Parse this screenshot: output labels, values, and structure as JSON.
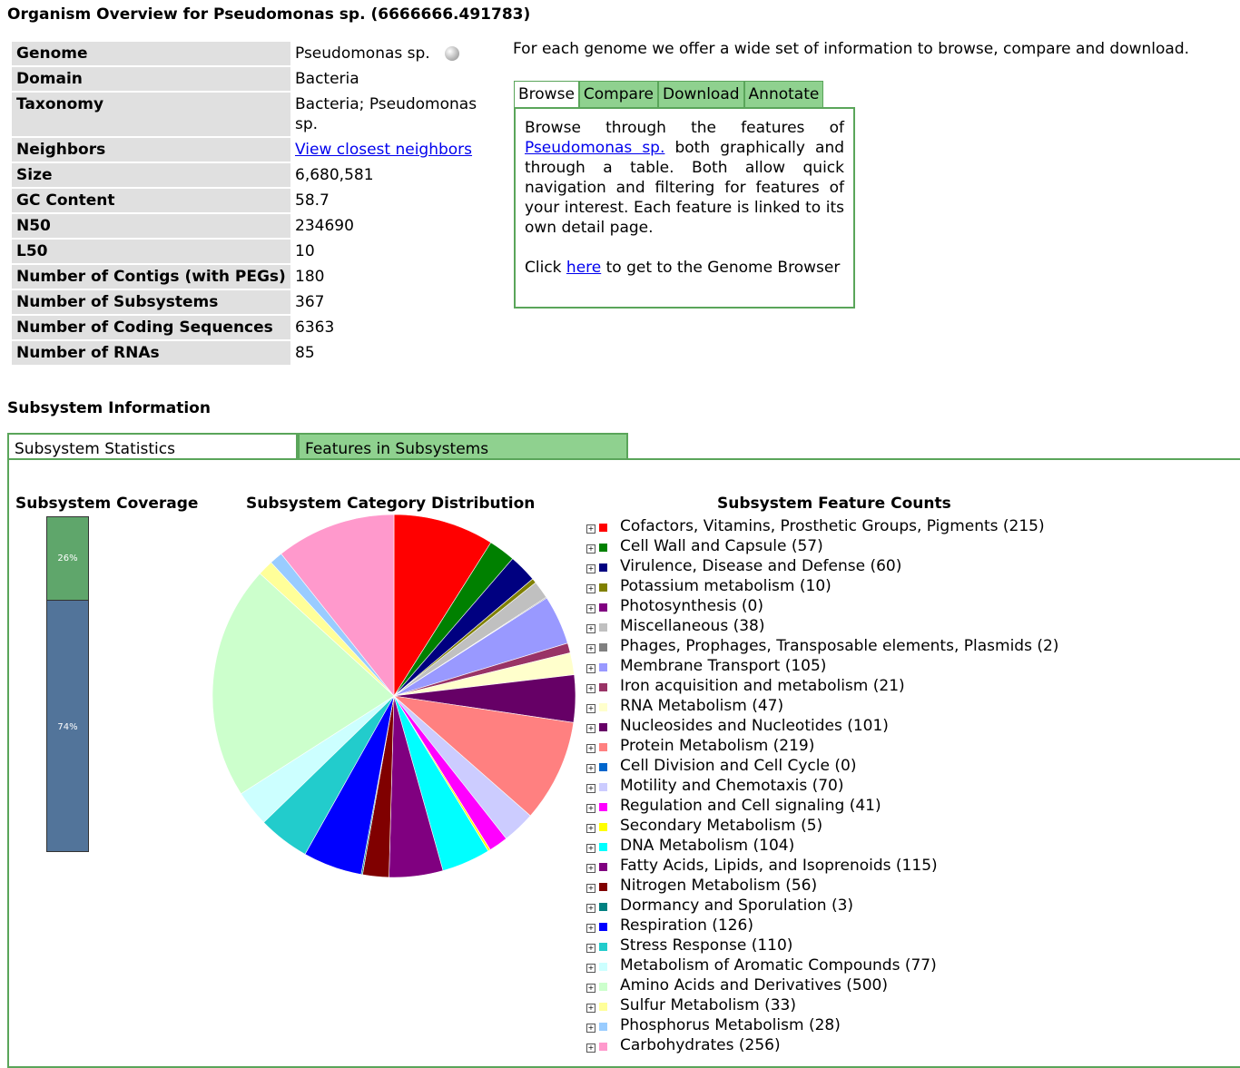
{
  "title": "Organism Overview for Pseudomonas sp. (6666666.491783)",
  "overview": [
    {
      "label": "Genome",
      "value": "Pseudomonas sp.",
      "globe": true
    },
    {
      "label": "Domain",
      "value": "Bacteria"
    },
    {
      "label": "Taxonomy",
      "value": "Bacteria; Pseudomonas sp."
    },
    {
      "label": "Neighbors",
      "value": "View closest neighbors",
      "link": true
    },
    {
      "label": "Size",
      "value": "6,680,581"
    },
    {
      "label": "GC Content",
      "value": "58.7"
    },
    {
      "label": "N50",
      "value": "234690"
    },
    {
      "label": "L50",
      "value": "10"
    },
    {
      "label": "Number of Contigs (with PEGs)",
      "value": "180"
    },
    {
      "label": "Number of Subsystems",
      "value": "367"
    },
    {
      "label": "Number of Coding Sequences",
      "value": "6363"
    },
    {
      "label": "Number of RNAs",
      "value": "85"
    }
  ],
  "intro": "For each genome we offer a wide set of information to browse, compare and download.",
  "tabs": [
    "Browse",
    "Compare",
    "Download",
    "Annotate"
  ],
  "browse": {
    "text1": "Browse through the features of",
    "link1": "Pseudomonas sp.",
    "text2": "both graphically and through a table. Both allow quick navigation and filtering for features of your interest. Each feature is linked to its own detail page.",
    "text3": "Click",
    "link2": "here",
    "text4": "to get to the Genome Browser"
  },
  "subsystem_info_title": "Subsystem Information",
  "subsystem_tabs": [
    "Subsystem Statistics",
    "Features in Subsystems"
  ],
  "coverage": {
    "title": "Subsystem Coverage",
    "in_subsystem": "26%",
    "not_in_subsystem": "74%",
    "fraction_in": 0.26
  },
  "pie_title": "Subsystem Category Distribution",
  "counts_title": "Subsystem Feature Counts",
  "chart_data": {
    "type": "pie",
    "title": "Subsystem Category Distribution",
    "series": [
      {
        "name": "Cofactors, Vitamins, Prosthetic Groups, Pigments",
        "value": 215,
        "color": "#ff0000"
      },
      {
        "name": "Cell Wall and Capsule",
        "value": 57,
        "color": "#008000"
      },
      {
        "name": "Virulence, Disease and Defense",
        "value": 60,
        "color": "#000080"
      },
      {
        "name": "Potassium metabolism",
        "value": 10,
        "color": "#808000"
      },
      {
        "name": "Photosynthesis",
        "value": 0,
        "color": "#800080"
      },
      {
        "name": "Miscellaneous",
        "value": 38,
        "color": "#c0c0c0"
      },
      {
        "name": "Phages, Prophages, Transposable elements, Plasmids",
        "value": 2,
        "color": "#808080"
      },
      {
        "name": "Membrane Transport",
        "value": 105,
        "color": "#9999ff"
      },
      {
        "name": "Iron acquisition and metabolism",
        "value": 21,
        "color": "#993366"
      },
      {
        "name": "RNA Metabolism",
        "value": 47,
        "color": "#ffffcc"
      },
      {
        "name": "Nucleosides and Nucleotides",
        "value": 101,
        "color": "#660066"
      },
      {
        "name": "Protein Metabolism",
        "value": 219,
        "color": "#ff8080"
      },
      {
        "name": "Cell Division and Cell Cycle",
        "value": 0,
        "color": "#0066cc"
      },
      {
        "name": "Motility and Chemotaxis",
        "value": 70,
        "color": "#ccccff"
      },
      {
        "name": "Regulation and Cell signaling",
        "value": 41,
        "color": "#ff00ff"
      },
      {
        "name": "Secondary Metabolism",
        "value": 5,
        "color": "#ffff00"
      },
      {
        "name": "DNA Metabolism",
        "value": 104,
        "color": "#00ffff"
      },
      {
        "name": "Fatty Acids, Lipids, and Isoprenoids",
        "value": 115,
        "color": "#800080"
      },
      {
        "name": "Nitrogen Metabolism",
        "value": 56,
        "color": "#800000"
      },
      {
        "name": "Dormancy and Sporulation",
        "value": 3,
        "color": "#008080"
      },
      {
        "name": "Respiration",
        "value": 126,
        "color": "#0000ff"
      },
      {
        "name": "Stress Response",
        "value": 110,
        "color": "#22cccc"
      },
      {
        "name": "Metabolism of Aromatic Compounds",
        "value": 77,
        "color": "#ccffff"
      },
      {
        "name": "Amino Acids and Derivatives",
        "value": 500,
        "color": "#ccffcc"
      },
      {
        "name": "Sulfur Metabolism",
        "value": 33,
        "color": "#ffff99"
      },
      {
        "name": "Phosphorus Metabolism",
        "value": 28,
        "color": "#99ccff"
      },
      {
        "name": "Carbohydrates",
        "value": 256,
        "color": "#ff99cc"
      }
    ]
  }
}
